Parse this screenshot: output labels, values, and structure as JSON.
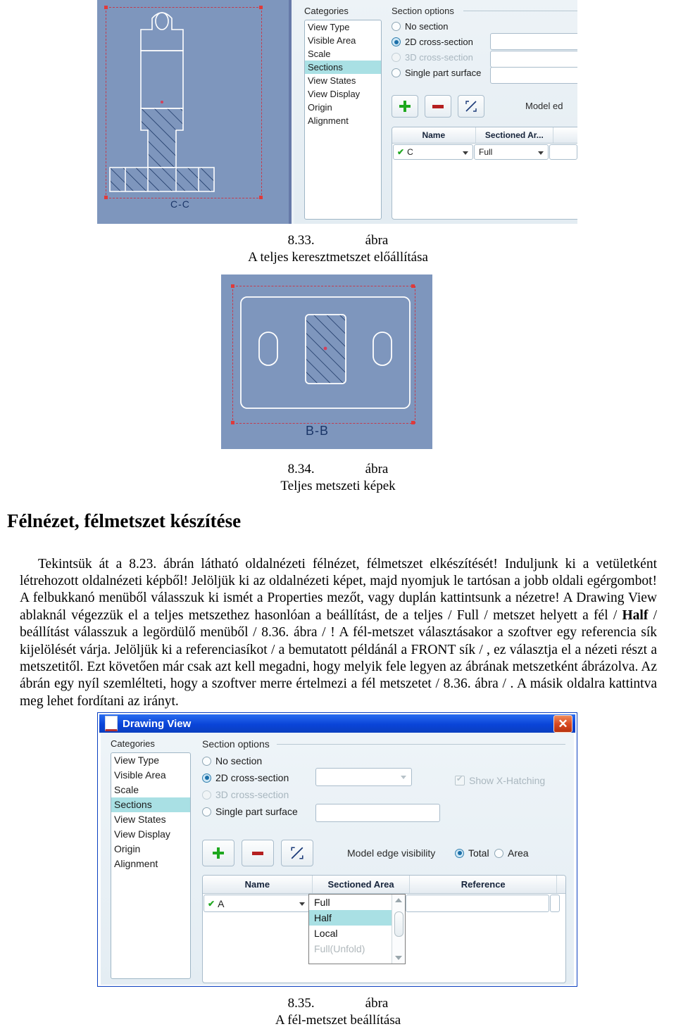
{
  "figure1": {
    "drawing_label": "C-C",
    "categories_title": "Categories",
    "categories": [
      "View Type",
      "Visible Area",
      "Scale",
      "Sections",
      "View States",
      "View Display",
      "Origin",
      "Alignment"
    ],
    "selected_category": "Sections",
    "section_options_title": "Section options",
    "radios": [
      "No section",
      "2D cross-section",
      "3D cross-section",
      "Single part surface"
    ],
    "selected_radio": "2D cross-section",
    "model_edge_label": "Model ed",
    "table_headers": [
      "Name",
      "Sectioned Ar..."
    ],
    "row_name": "C",
    "row_sectioned_area": "Full",
    "icons": {
      "add": "plus-icon",
      "remove": "minus-icon",
      "flip": "flip-arrow-icon"
    }
  },
  "caption1": {
    "number": "8.33.",
    "word": "ábra",
    "text": "A teljes keresztmetszet előállítása"
  },
  "figure2": {
    "label": "B-B"
  },
  "caption2": {
    "number": "8.34.",
    "word": "ábra",
    "text": "Teljes metszeti képek"
  },
  "section_heading": "Félnézet, félmetszet készítése",
  "body": {
    "part1": "Tekintsük át a 8.23. ábrán látható oldalnézeti félnézet, félmetszet elkészítését! Induljunk ki a vetületként létrehozott oldalnézeti képből! Jelöljük ki az oldalnézeti képet, majd nyomjuk le tartósan a jobb oldali egérgombot! A felbukkanó menüből válasszuk ki ismét a Properties mezőt, vagy duplán kattintsunk a nézetre! A Drawing View ablaknál végezzük el a teljes metszethez hasonlóan a beállítást, de a teljes / Full / metszet helyett a fél / ",
    "bold1": "Half",
    "part2": " / beállítást válasszuk a legördülő menüből / 8.36. ábra / ! A fél-metszet választásakor a szoftver egy referencia sík kijelölését várja. Jelöljük ki  a referenciasíkot / a bemutatott példánál a FRONT sík / , ez választja el a nézeti részt a metszetitől. Ezt követően már csak azt kell megadni, hogy melyik fele legyen az ábrának metszetként ábrázolva. Az ábrán egy nyíl szemlélteti, hogy a szoftver merre értelmezi a fél metszetet / 8.36. ábra / . A másik oldalra kattintva meg lehet fordítani az irányt."
  },
  "figure3": {
    "window_title": "Drawing View",
    "close_label": "✕",
    "categories_title": "Categories",
    "categories": [
      "View Type",
      "Visible Area",
      "Scale",
      "Sections",
      "View States",
      "View Display",
      "Origin",
      "Alignment"
    ],
    "selected_category": "Sections",
    "section_options_title": "Section options",
    "radios": [
      "No section",
      "2D cross-section",
      "3D cross-section",
      "Single part surface"
    ],
    "selected_radio": "2D cross-section",
    "show_xhatching_label": "Show X-Hatching",
    "show_xhatching_checked": true,
    "model_edge_visibility_label": "Model edge visibility",
    "model_edge_options": [
      "Total",
      "Area"
    ],
    "model_edge_selected": "Total",
    "table_headers": [
      "Name",
      "Sectioned Area",
      "Reference"
    ],
    "row_name": "A",
    "row_sectioned_area": "Full",
    "dropdown_options": [
      "Full",
      "Half",
      "Local",
      "Full(Unfold)"
    ],
    "dropdown_selected": "Half",
    "dropdown_disabled": "Full(Unfold)",
    "icons": {
      "add": "plus-icon",
      "remove": "minus-icon",
      "flip": "flip-arrow-icon"
    }
  },
  "caption3": {
    "number": "8.35.",
    "word": "ábra",
    "text": "A fél-metszet beállítása"
  },
  "colors": {
    "drawing_bg": "#7e96bd",
    "titlebar": "#0a44d8",
    "highlight": "#a9e0e4",
    "accent_red": "#c33b4e",
    "green": "#1ea81e"
  }
}
